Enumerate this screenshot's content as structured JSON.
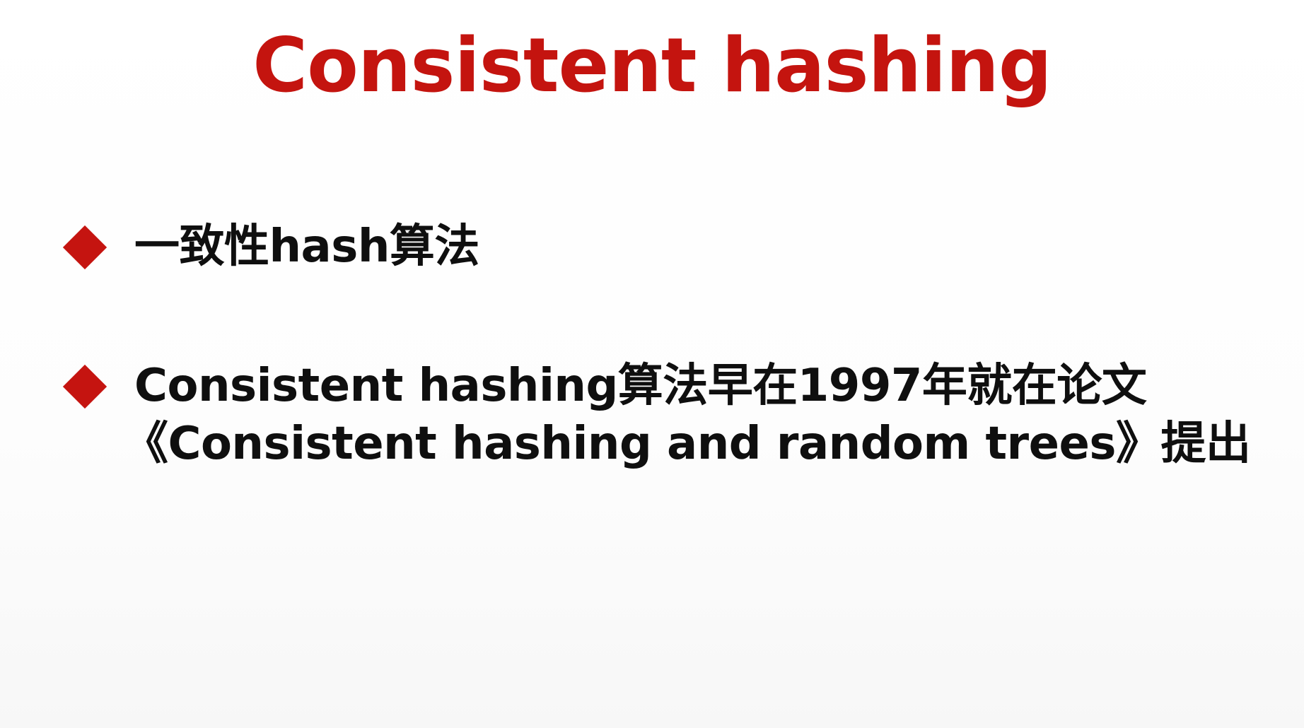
{
  "slide": {
    "title": "Consistent hashing",
    "bullets": [
      {
        "lines": [
          "一致性hash算法"
        ]
      },
      {
        "lines": [
          "Consistent hashing算法早在1997年就在论文",
          "《Consistent hashing and random trees》提出"
        ]
      }
    ]
  },
  "colors": {
    "title": "#c4140f",
    "bullet_marker": "#c51410",
    "text": "#0f0f0f",
    "background": "#ffffff"
  },
  "icons": {
    "bullet_marker": "red-diamond-icon"
  }
}
